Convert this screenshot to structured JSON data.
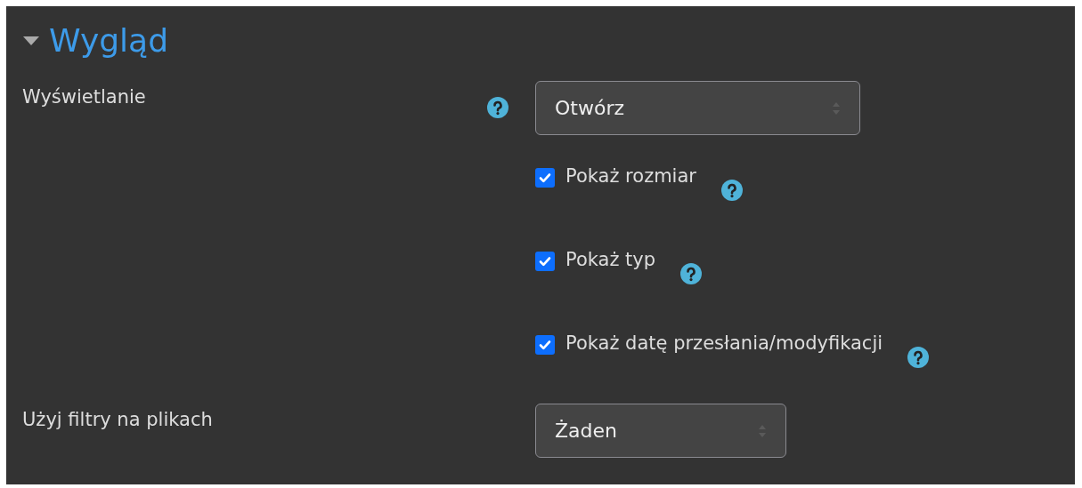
{
  "section": {
    "title": "Wygląd",
    "expanded": true
  },
  "fields": [
    {
      "kind": "select",
      "label": "Wyświetlanie",
      "help": true,
      "value": "Otwórz"
    },
    {
      "kind": "checkbox",
      "label": "Pokaż rozmiar",
      "checked": true,
      "help": true
    },
    {
      "kind": "checkbox",
      "label": "Pokaż typ",
      "checked": true,
      "help": true
    },
    {
      "kind": "checkbox",
      "label": "Pokaż datę przesłania/modyfikacji",
      "checked": true,
      "help": true
    },
    {
      "kind": "select",
      "label": "Użyj filtry na plikach",
      "help": false,
      "value": "Żaden"
    }
  ]
}
